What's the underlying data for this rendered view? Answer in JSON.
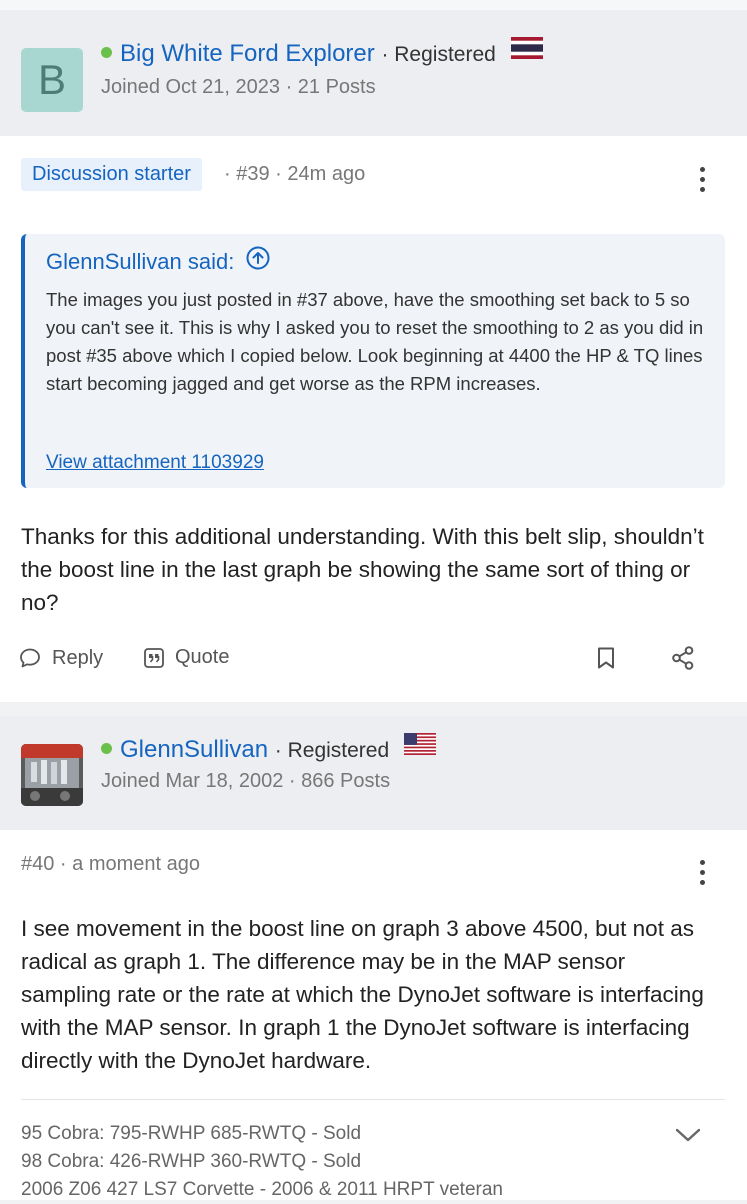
{
  "post1": {
    "avatar_letter": "B",
    "username": "Big White Ford Explorer",
    "role": "· Registered",
    "joined": "Joined Oct 21, 2023 · 21 Posts",
    "flag": "thailand-flag",
    "badge": "Discussion starter",
    "meta": "· #39 · 24m ago",
    "quote": {
      "author": "GlennSullivan said:",
      "text": "The images you just posted in #37 above, have the smoothing set back to 5 so you can't see it. This is why I asked you to reset the smoothing to 2 as you did in post #35 above which I copied below. Look beginning at 4400 the HP & TQ lines start becoming jagged and get worse as the RPM increases.",
      "attachment": "View attachment 1103929"
    },
    "body": "Thanks for this additional understanding. With this belt slip, shouldn’t the boost line in the last graph be showing the same sort of thing or no?",
    "actions": {
      "reply": "Reply",
      "quote": "Quote"
    }
  },
  "post2": {
    "username": "GlennSullivan",
    "role": "· Registered",
    "joined": "Joined Mar 18, 2002 · 866 Posts",
    "flag": "us-flag",
    "meta": "#40 · a moment ago",
    "body": "I see movement in the boost line on graph 3 above 4500, but not as radical as graph 1. The difference may be in the MAP sensor sampling rate or the rate at which the DynoJet software is interfacing with the MAP sensor. In graph 1 the DynoJet software is interfacing directly with the DynoJet hardware.",
    "signature": [
      "95 Cobra: 795-RWHP 685-RWTQ - Sold",
      "98 Cobra: 426-RWHP 360-RWTQ - Sold",
      "2006 Z06 427 LS7 Corvette - 2006 & 2011 HRPT veteran"
    ]
  },
  "colors": {
    "link": "#1565c0",
    "online": "#6ac04a",
    "avatar_bg": "#a7d7d0"
  }
}
